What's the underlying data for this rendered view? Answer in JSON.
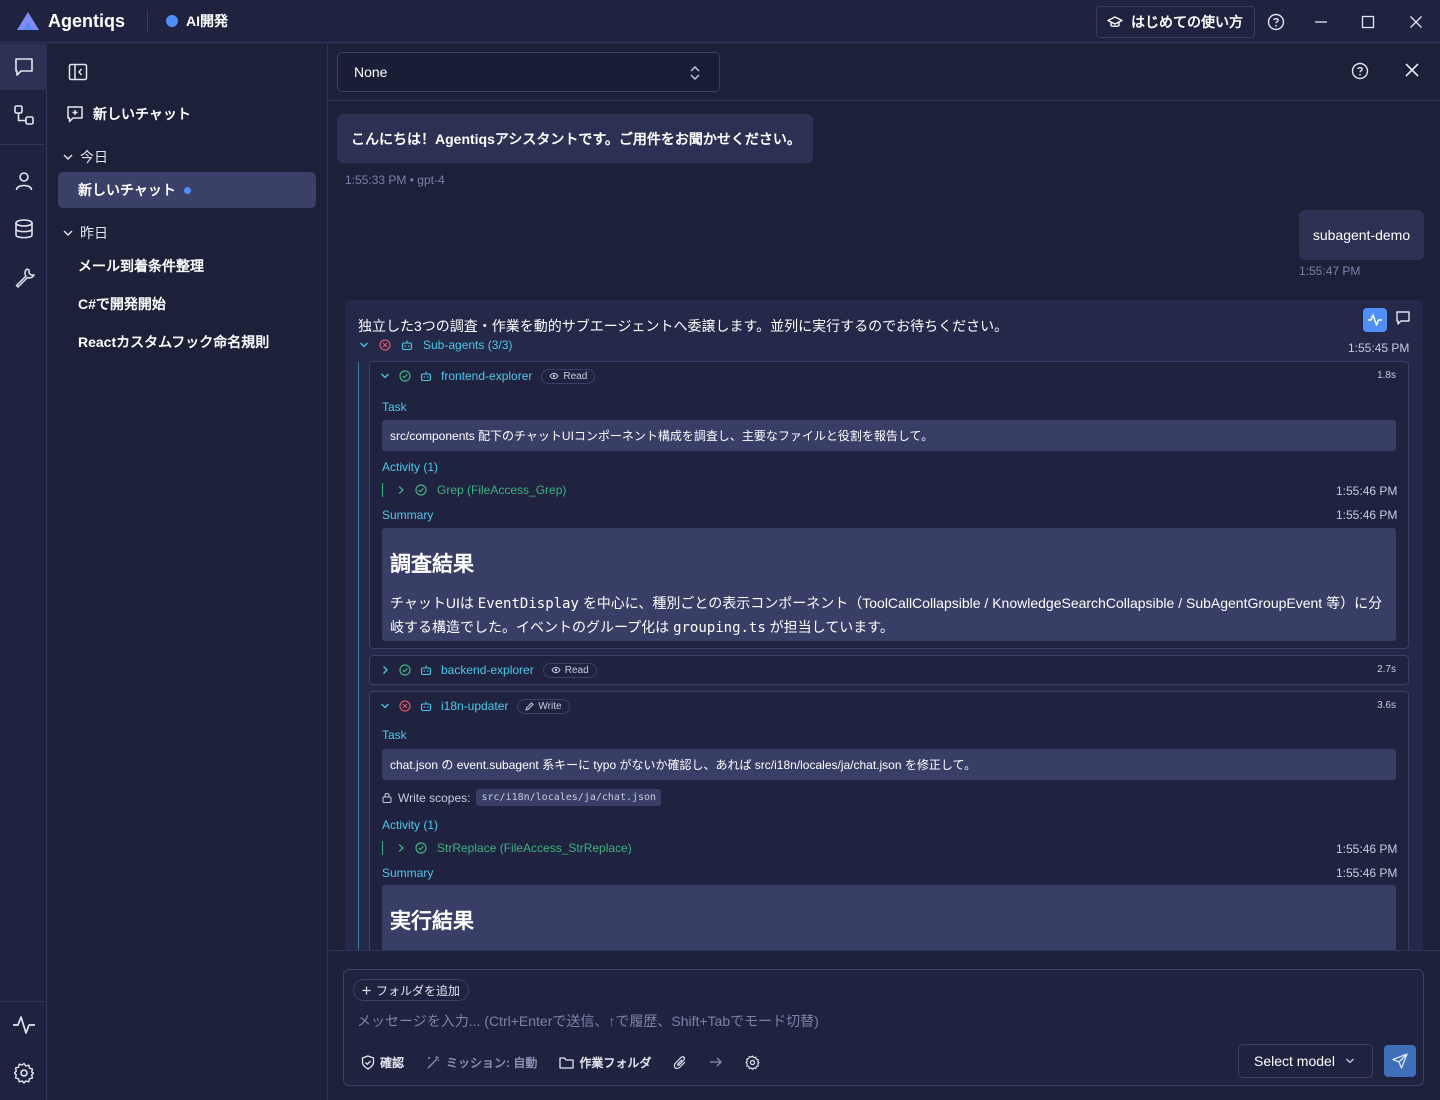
{
  "titlebar": {
    "app_title": "Agentiqs",
    "project_name": "AI開発",
    "guide_label": "はじめての使い方"
  },
  "sidebar": {
    "new_chat_label": "新しいチャット",
    "groups": [
      {
        "label": "今日",
        "items": [
          "新しいチャット"
        ]
      },
      {
        "label": "昨日",
        "items": [
          "メール到着条件整理",
          "C#で開発開始",
          "Reactカスタムフック命名規則"
        ]
      }
    ]
  },
  "header": {
    "selector_value": "None"
  },
  "messages": {
    "assistant_greeting": "こんにちは！Agentiqsアシスタントです。ご用件をお聞かせください。",
    "assistant_meta_time": "1:55:33 PM",
    "assistant_meta_model": "gpt-4",
    "user_text": "subagent-demo",
    "user_time": "1:55:47 PM",
    "response": {
      "intro": "独立した3つの調査・作業を動的サブエージェントへ委譲します。並列に実行するのでお待ちください。",
      "group_label": "Sub-agents (3/3)",
      "group_time": "1:55:45 PM",
      "agents": [
        {
          "name": "frontend-explorer",
          "mode": "Read",
          "duration": "1.8s",
          "task_label": "Task",
          "task": "src/components 配下のチャットUIコンポーネント構成を調査し、主要なファイルと役割を報告して。",
          "activity_label": "Activity (1)",
          "activity_item": "Grep (FileAccess_Grep)",
          "activity_time": "1:55:46 PM",
          "summary_label": "Summary",
          "summary_time": "1:55:46 PM",
          "summary_title": "調査結果",
          "summary_p1": "チャットUIは",
          "summary_code1": "EventDisplay",
          "summary_p2": "を中心に、種別ごとの表示コンポーネント（ToolCallCollapsible / KnowledgeSearchCollapsible / SubAgentGroupEvent 等）に分岐する構造でした。イベントのグループ化は",
          "summary_code2": "grouping.ts",
          "summary_p3": "が担当しています。"
        },
        {
          "name": "backend-explorer",
          "mode": "Read",
          "duration": "2.7s"
        },
        {
          "name": "i18n-updater",
          "mode": "Write",
          "duration": "3.6s",
          "task_label": "Task",
          "task": "chat.json の event.subagent 系キーに typo がないか確認し、あれば src/i18n/locales/ja/chat.json を修正して。",
          "write_scopes_label": "Write scopes:",
          "write_scope": "src/i18n/locales/ja/chat.json",
          "activity_label": "Activity (1)",
          "activity_item": "StrReplace (FileAccess_StrReplace)",
          "activity_time": "1:55:46 PM",
          "summary_label": "Summary",
          "summary_time": "1:55:46 PM",
          "summary_title": "実行結果"
        }
      ]
    }
  },
  "composer": {
    "add_folder_label": "フォルダを追加",
    "placeholder": "メッセージを入力... (Ctrl+Enterで送信、↑で履歴、Shift+Tabでモード切替)",
    "tools": {
      "confirm": "確認",
      "mission": "ミッション: 自動",
      "work_folder": "作業フォルダ"
    },
    "model_select": "Select model"
  },
  "colors": {
    "accent_blue": "#4f8ff7",
    "cyan_label": "#4fc7e8",
    "success_green": "#3fb27f",
    "error_red": "#e0556b"
  }
}
